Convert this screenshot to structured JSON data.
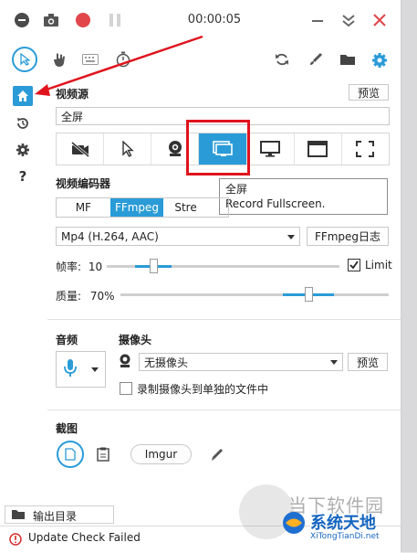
{
  "titlebar": {
    "time": "00:00:05",
    "icons": [
      "record-dot-icon",
      "camera-icon",
      "record-button-icon",
      "pause-icon",
      "minimize-icon",
      "collapse-icon",
      "close-icon"
    ]
  },
  "toolbar": {
    "left_icons": [
      "cursor-icon",
      "hand-icon",
      "keyboard-icon",
      "timer-icon"
    ],
    "right_icons": [
      "refresh-icon",
      "brush-icon",
      "folder-icon",
      "settings-icon"
    ]
  },
  "sidebar": {
    "items": [
      "home-icon",
      "history-icon",
      "gear-icon",
      "help-icon"
    ],
    "help_label": "?"
  },
  "video_source": {
    "title": "视频源",
    "preview_label": "预览",
    "current_value": "全屏",
    "options": [
      "no-video-icon",
      "cursor-region-icon",
      "webcam-icon",
      "fullscreen-monitor-icon",
      "monitor-icon",
      "window-icon",
      "region-icon"
    ],
    "selected_index": 3
  },
  "tooltip": {
    "title": "全屏",
    "description": "Record Fullscreen."
  },
  "video_encoder": {
    "title": "视频编码器",
    "tabs": [
      "MF",
      "FFmpeg",
      "Stre"
    ],
    "active_tab": 1,
    "codec": "Mp4 (H.264, AAC)",
    "log_button": "FFmpeg日志",
    "framerate_label": "帧率:",
    "framerate_value": "10",
    "framerate_fraction": 0.2,
    "limit_label": "Limit",
    "limit_checked": true,
    "quality_label": "质量:",
    "quality_value": "70%",
    "quality_fraction": 0.7
  },
  "audio": {
    "title": "音频"
  },
  "webcam": {
    "title": "摄像头",
    "selected": "无摄像头",
    "preview_label": "预览",
    "separate_file_label": "录制摄像头到单独的文件中"
  },
  "screenshot": {
    "title": "截图",
    "imgur_label": "Imgur"
  },
  "output": {
    "label": "输出目录"
  },
  "status": {
    "text": "Update Check Failed"
  },
  "watermark": {
    "top": "当下软件园",
    "brand": "系统天地",
    "url": "XiTongTianDi.net"
  },
  "colors": {
    "accent": "#2a9bd7",
    "record_red": "#e0464a",
    "highlight_box": "#e0141e"
  }
}
